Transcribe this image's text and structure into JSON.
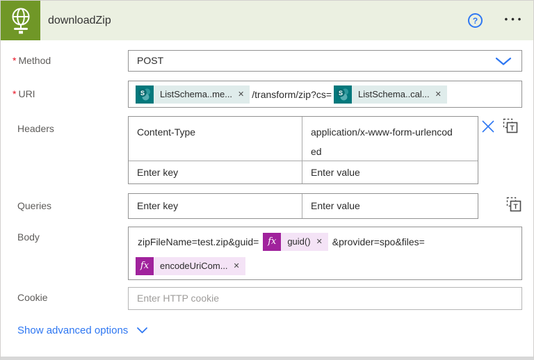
{
  "ui": {
    "required_mark": "*",
    "close_glyph": "✕",
    "help_glyph": "?",
    "more_glyph": "•••",
    "sharepoint_letter": "S",
    "fx_label": "fx",
    "text_mode_letter": "T"
  },
  "colors": {
    "header_bg": "#EBF0E1",
    "connector_green": "#709727",
    "sharepoint_teal": "#03787C",
    "sharepoint_token_bg": "#DFECEB",
    "expression_magenta": "#A0229C",
    "expression_token_bg": "#F4E3F6",
    "accent_blue": "#2E77F2",
    "required_red": "#E81123"
  },
  "header": {
    "title": "downloadZip"
  },
  "fields": {
    "method": {
      "label": "Method",
      "required": true,
      "value": "POST"
    },
    "uri": {
      "label": "URI",
      "required": true,
      "tokens": [
        {
          "connector": "sharepoint",
          "label": "ListSchema..me..."
        },
        {
          "connector": "sharepoint",
          "label": "ListSchema..cal..."
        }
      ],
      "between_text": "/transform/zip?cs="
    },
    "headers": {
      "label": "Headers",
      "rows": [
        {
          "key": "Content-Type",
          "value": "application/x-www-form-urlencoded"
        }
      ],
      "key_placeholder": "Enter key",
      "value_placeholder": "Enter value"
    },
    "queries": {
      "label": "Queries",
      "key_placeholder": "Enter key",
      "value_placeholder": "Enter value"
    },
    "body": {
      "label": "Body",
      "segments": [
        {
          "type": "text",
          "text": "zipFileName=test.zip&guid="
        },
        {
          "type": "expression-token",
          "label": "guid()"
        },
        {
          "type": "text",
          "text": "&provider=spo&files="
        },
        {
          "type": "expression-token",
          "label": "encodeUriCom..."
        }
      ]
    },
    "cookie": {
      "label": "Cookie",
      "placeholder": "Enter HTTP cookie"
    }
  },
  "footer": {
    "advanced_label": "Show advanced options"
  }
}
